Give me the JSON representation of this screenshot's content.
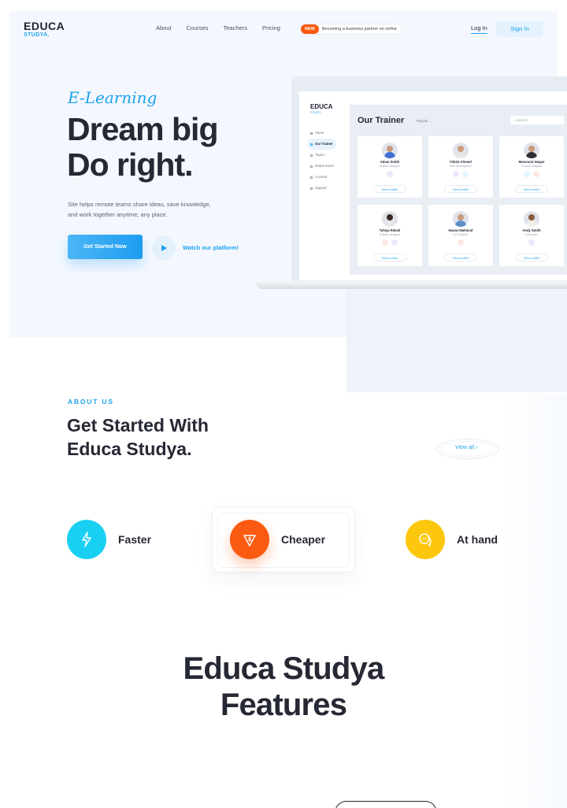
{
  "brand": {
    "name": "EDUCA",
    "sub": "STUDYA."
  },
  "nav": [
    "About",
    "Courses",
    "Teachers",
    "Pricing"
  ],
  "promo": {
    "badge": "NEW",
    "text": "Becoming a business partner on online"
  },
  "auth": {
    "login": "Log In",
    "signin": "Sign In"
  },
  "hero": {
    "tagline": "E-Learning",
    "headline_1": "Dream big",
    "headline_2": "Do right.",
    "desc_1": "Site helps remote teams share ideas, save knowledge,",
    "desc_2": "and work together anytime, any place.",
    "cta": "Get Started Now",
    "watch": "Watch our platform!"
  },
  "mockup": {
    "brand": "EDUCA",
    "brand_sub": "STUDY.",
    "menu": [
      "Home",
      "Our Trainer",
      "Topics",
      "Online Exam",
      "Account",
      "Support"
    ],
    "title": "Our Trainer",
    "filter": "Popular ⌄",
    "search": "Search",
    "view_label": "View profile",
    "trainers": [
      {
        "name": "Adam Smith",
        "role": "Graphic Designer"
      },
      {
        "name": "Fahim Ahmed",
        "role": "Web Development"
      },
      {
        "name": "Monsurul Haque",
        "role": "Product Designer"
      },
      {
        "name": "Tahiya Rekah",
        "role": "Graphic Designer"
      },
      {
        "name": "Hasan Mahmud",
        "role": "UX Designer"
      },
      {
        "name": "Andy Smith",
        "role": "Developer"
      }
    ]
  },
  "about": {
    "label": "ABOUT US",
    "title_1": "Get Started With",
    "title_2": "Educa Studya.",
    "view_all": "View all ›"
  },
  "benefits": [
    {
      "label": "Faster",
      "color": "#1ad0f2",
      "icon": "lightning-icon"
    },
    {
      "label": "Cheaper",
      "color": "#fb5a12",
      "icon": "dollar-icon"
    },
    {
      "label": "At hand",
      "color": "#fdc70d",
      "icon": "chat-bubbles-icon"
    }
  ],
  "features": {
    "title_1": "Educa Studya",
    "title_2": "Features"
  },
  "colors": {
    "accent": "#1da1ef",
    "dark": "#262834"
  }
}
